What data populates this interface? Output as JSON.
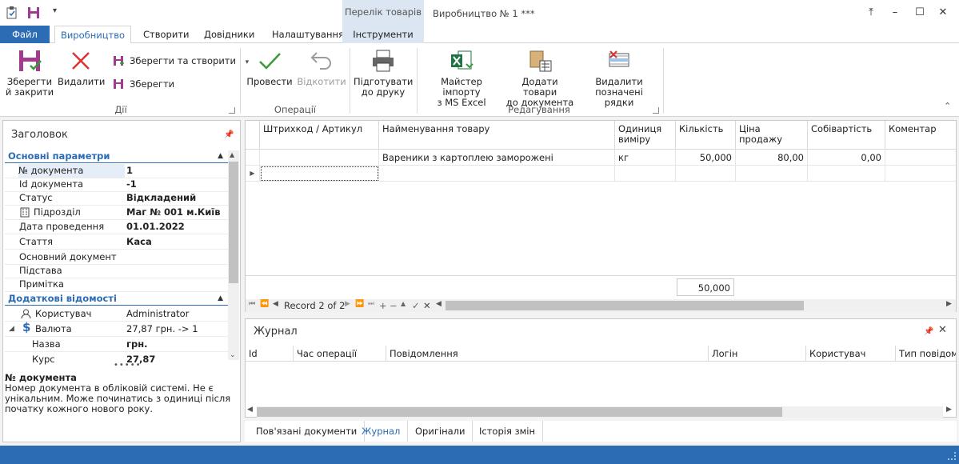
{
  "window": {
    "context_group": "Перелік товарів",
    "doc_title": "Виробництво № 1 ***"
  },
  "tabs": {
    "file": "Файл",
    "items": [
      "Виробництво",
      "Створити",
      "Довідники",
      "Налаштування",
      "Інструменти"
    ]
  },
  "ribbon": {
    "save_close": "Зберегти\nй закрити",
    "delete": "Видалити",
    "save_create": "Зберегти та створити",
    "save": "Зберегти",
    "group_actions": "Дії",
    "post": "Провести",
    "unpost": "Відкотити",
    "group_operations": "Операції",
    "print_prepare": "Підготувати\nдо друку",
    "import_master": "Майстер імпорту\nз MS Excel",
    "add_goods": "Додати товари\nдо документа",
    "delete_marked": "Видалити\nпозначені рядки",
    "group_edit": "Редагування"
  },
  "left": {
    "header": "Заголовок",
    "cat_main": "Основні параметри",
    "cat_extra": "Додаткові відомості",
    "rows": [
      {
        "k": "№ документа",
        "v": "1"
      },
      {
        "k": "Id документа",
        "v": "-1"
      },
      {
        "k": "Статус",
        "v": "Відкладений"
      },
      {
        "k": "Підрозділ",
        "v": "Маг № 001 м.Київ"
      },
      {
        "k": "Дата проведення",
        "v": "01.01.2022"
      },
      {
        "k": "Стаття",
        "v": "Каса"
      },
      {
        "k": "Основний документ",
        "v": ""
      },
      {
        "k": "Підстава",
        "v": ""
      },
      {
        "k": "Примітка",
        "v": ""
      }
    ],
    "extra_rows": [
      {
        "k": "Користувач",
        "v": "Administrator"
      },
      {
        "k": "Валюта",
        "v": "27,87 грн. -> 1"
      },
      {
        "k": "Назва",
        "v": "грн."
      },
      {
        "k": "Курс",
        "v": "27,87"
      }
    ],
    "desc_title": "№ документа",
    "desc_text": "Номер документа в обліковій системі. Не є унікальним. Може починатись з одиниці після початку кожного нового року."
  },
  "grid": {
    "columns": [
      "Штрихкод / Артикул",
      "Найменування товару",
      "Одиниця виміру",
      "Кількість",
      "Ціна продажу",
      "Собівартість",
      "Коментар"
    ],
    "rows": [
      [
        "",
        "Вареники з картоплею заморожені",
        "кг",
        "50,000",
        "80,00",
        "0,00",
        ""
      ]
    ],
    "total_qty": "50,000",
    "record_label": "Record 2 of 2"
  },
  "journal": {
    "title": "Журнал",
    "columns": [
      "Id",
      "Час операції",
      "Повідомлення",
      "Логін",
      "Користувач",
      "Тип повідом..."
    ]
  },
  "bottom_tabs": [
    "Пов'язані документи",
    "Журнал",
    "Оригінали",
    "Історія змін"
  ]
}
